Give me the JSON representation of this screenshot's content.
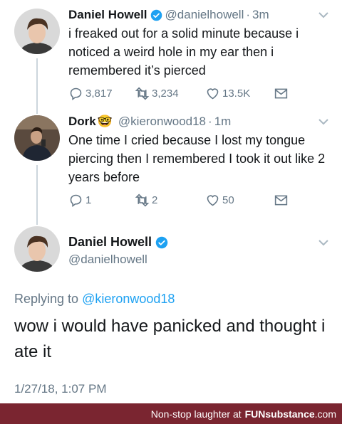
{
  "tweets": [
    {
      "name": "Daniel Howell",
      "handle": "@danielhowell",
      "time": "3m",
      "text": "i freaked out for a solid minute because i noticed a weird hole in my ear then i remembered it’s pierced",
      "replies": "3,817",
      "retweets": "3,234",
      "likes": "13.5K",
      "verified": true
    },
    {
      "name": "Dork",
      "emoji": "🤓",
      "handle": "@kieronwood18",
      "time": "1m",
      "text": "One time I cried because I lost my tongue piercing then I remembered I took it out like 2 years before",
      "replies": "1",
      "retweets": "2",
      "likes": "50",
      "verified": false
    }
  ],
  "main_tweet": {
    "name": "Daniel Howell",
    "handle": "@danielhowell",
    "replying_prefix": "Replying to",
    "replying_to": "@kieronwood18",
    "text": "wow i would have panicked and thought i ate it",
    "date": "1/27/18, 1:07 PM"
  },
  "footer": {
    "prefix": "Non-stop laughter at",
    "brand": "FUNsubstance",
    "brand_end": ".com"
  },
  "colors": {
    "accent": "#1da1f2",
    "muted": "#657786",
    "footer_bg": "#7a2530"
  },
  "icons": [
    "reply-icon",
    "retweet-icon",
    "like-icon",
    "dm-icon",
    "verified-icon",
    "caret-down-icon"
  ]
}
